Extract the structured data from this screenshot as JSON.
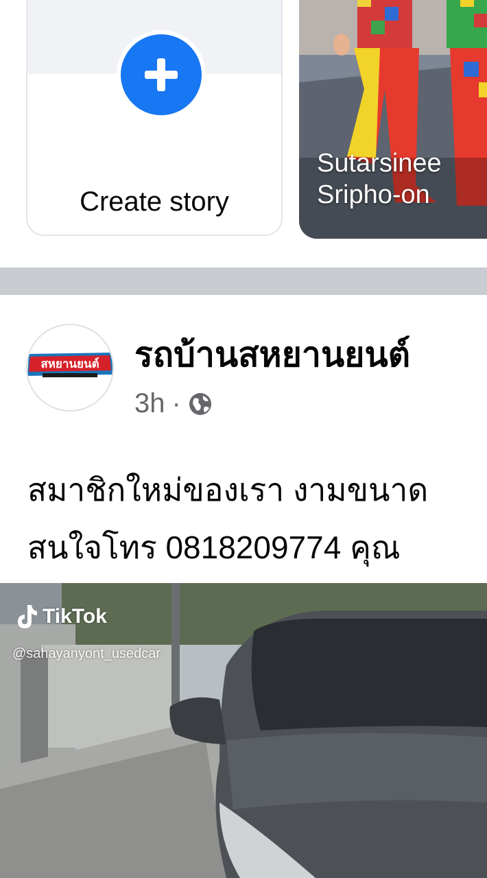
{
  "stories": {
    "create": {
      "label": "Create story",
      "icon": "plus-icon"
    },
    "items": [
      {
        "name_line1": "Sutarsinee",
        "name_line2": "Sripho-on"
      }
    ]
  },
  "post": {
    "page_name": "รถบ้านสหยานยนต์",
    "time": "3h",
    "separator": "·",
    "privacy_icon": "globe-icon",
    "avatar_logo_text": "สหยานยนต์",
    "text_lines": [
      "สมาชิกใหม่ของเรา งามขนาด",
      "สนใจโทร 0818209774 คุณ"
    ],
    "video": {
      "watermark": "TikTok",
      "handle": "@sahayanyont_usedcar"
    }
  },
  "colors": {
    "accent": "#1877f2",
    "separator": "#c9ccd1",
    "secondary_text": "#65676b"
  }
}
